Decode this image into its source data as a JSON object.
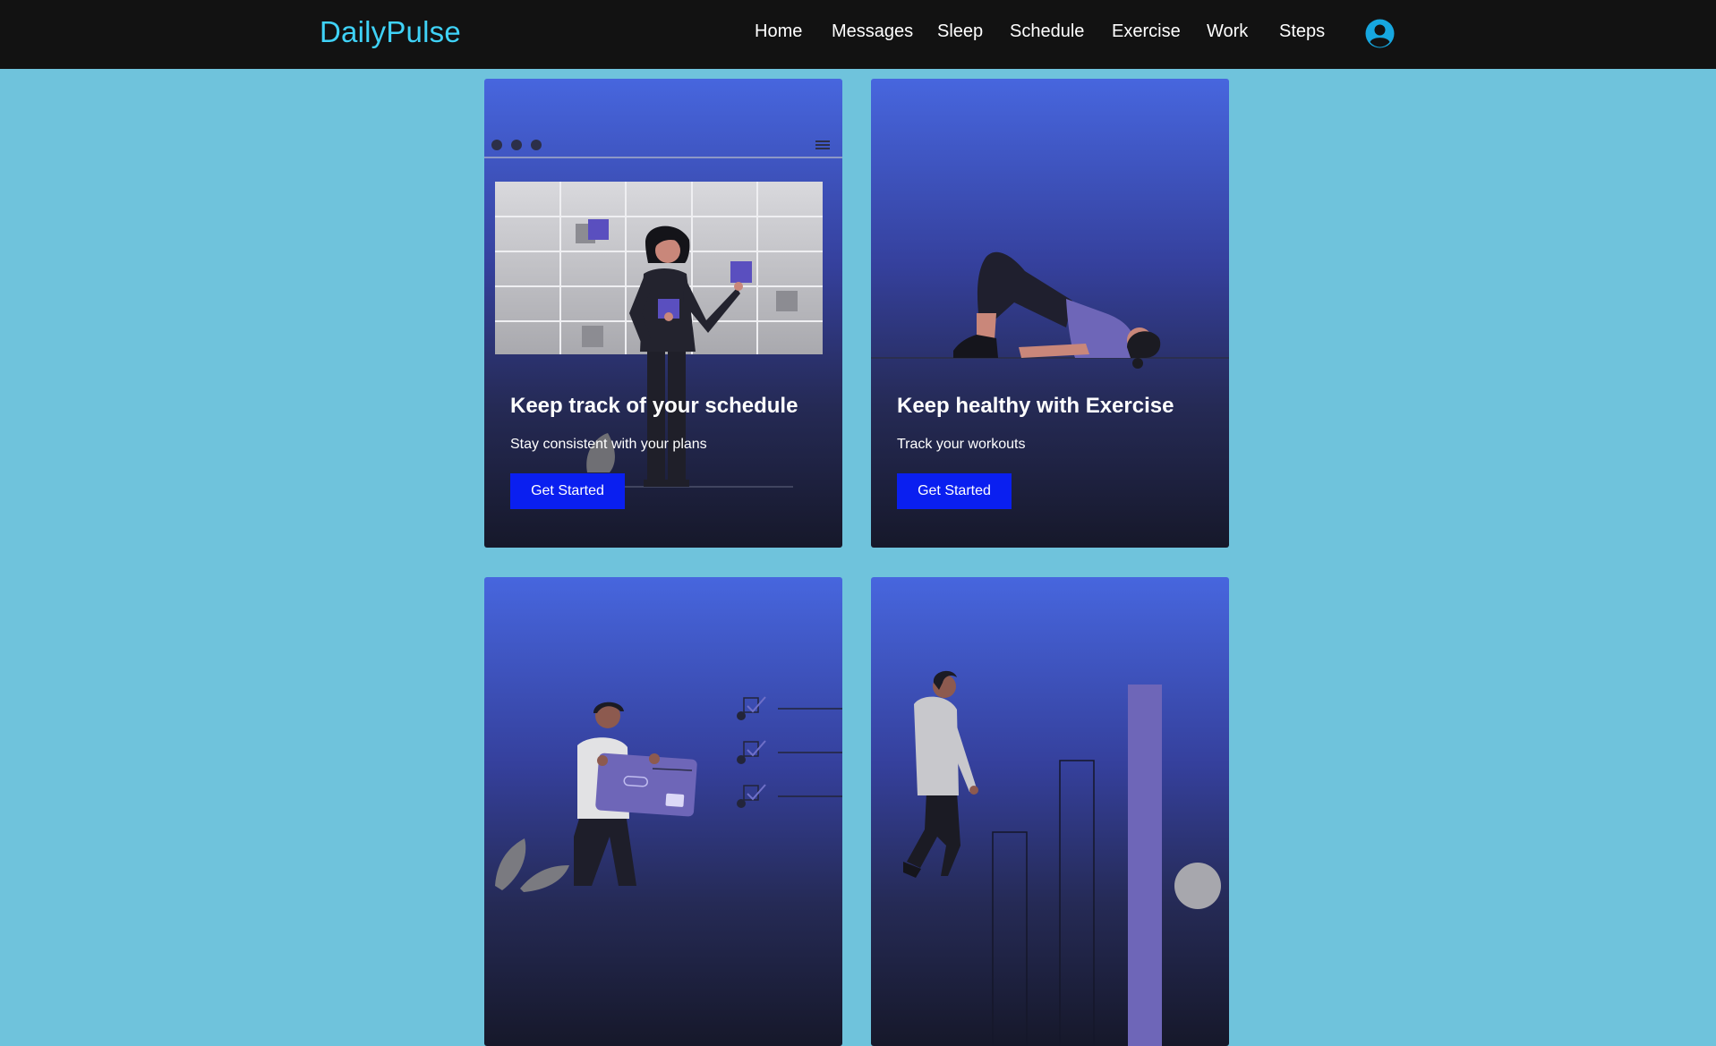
{
  "navbar": {
    "brand": "DailyPulse",
    "links": [
      "Home",
      "Messages",
      "Sleep",
      "Schedule",
      "Exercise",
      "Work",
      "Steps"
    ],
    "profile_icon": "user-circle-icon"
  },
  "cards": [
    {
      "title": "Keep track of your schedule",
      "text": "Stay consistent with your plans",
      "button": "Get Started",
      "illustration": "schedule-illustration"
    },
    {
      "title": "Keep healthy with Exercise",
      "text": "Track your workouts",
      "button": "Get Started",
      "illustration": "exercise-illustration"
    },
    {
      "illustration": "work-illustration"
    },
    {
      "illustration": "steps-illustration"
    }
  ],
  "colors": {
    "page_background": "#6fc3dc",
    "navbar_background": "#121212",
    "brand": "#3fd2f7",
    "button": "#0a1ff0",
    "card_gradient_top": "#4766de",
    "card_gradient_bottom": "#16182a"
  }
}
